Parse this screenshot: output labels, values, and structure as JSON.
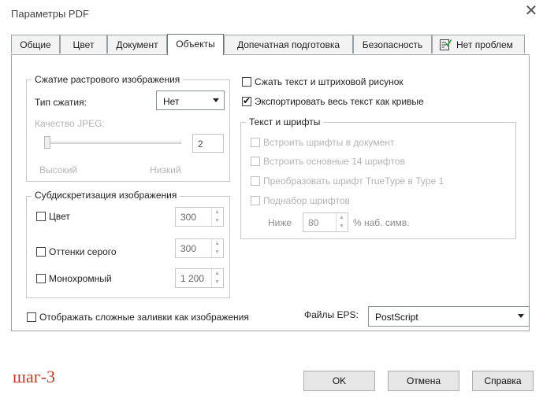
{
  "window": {
    "title": "Параметры PDF",
    "close_symbol": "✕"
  },
  "tabs": [
    {
      "label": "Общие"
    },
    {
      "label": "Цвет"
    },
    {
      "label": "Документ"
    },
    {
      "label": "Объекты"
    },
    {
      "label": "Допечатная подготовка"
    },
    {
      "label": "Безопасность"
    },
    {
      "label": "Нет проблем"
    }
  ],
  "raster": {
    "group_label": "Сжатие растрового изображения",
    "compression_label": "Тип сжатия:",
    "compression_value": "Нет",
    "jpeg_label": "Качество JPEG:",
    "jpeg_value": "2",
    "high_label": "Высокий",
    "low_label": "Низкий"
  },
  "subsample": {
    "group_label": "Субдискретизация изображения",
    "color_label": "Цвет",
    "color_value": "300",
    "gray_label": "Оттенки серого",
    "gray_value": "300",
    "mono_label": "Монохромный",
    "mono_value": "1 200"
  },
  "options": {
    "compress_text_label": "Сжать текст и штриховой рисунок",
    "compress_text_checked": false,
    "export_curves_label": "Экспортировать весь текст как кривые",
    "export_curves_checked": true,
    "complex_fills_label": "Отображать сложные заливки как изображения",
    "complex_fills_checked": false
  },
  "fonts": {
    "group_label": "Текст и шрифты",
    "embed_label": "Встроить шрифты в документ",
    "embed14_label": "Встроить основные 14 шрифтов",
    "convert_label": "Преобразовать шрифт TrueType в Type 1",
    "subset_label": "Поднабор шрифтов",
    "below_label": "Ниже",
    "below_value": "80",
    "percent_label": "% наб. симв."
  },
  "eps": {
    "label": "Файлы EPS:",
    "value": "PostScript"
  },
  "buttons": {
    "ok": "OK",
    "cancel": "Отмена",
    "help": "Справка"
  },
  "annotation": {
    "step": "шаг-3"
  }
}
